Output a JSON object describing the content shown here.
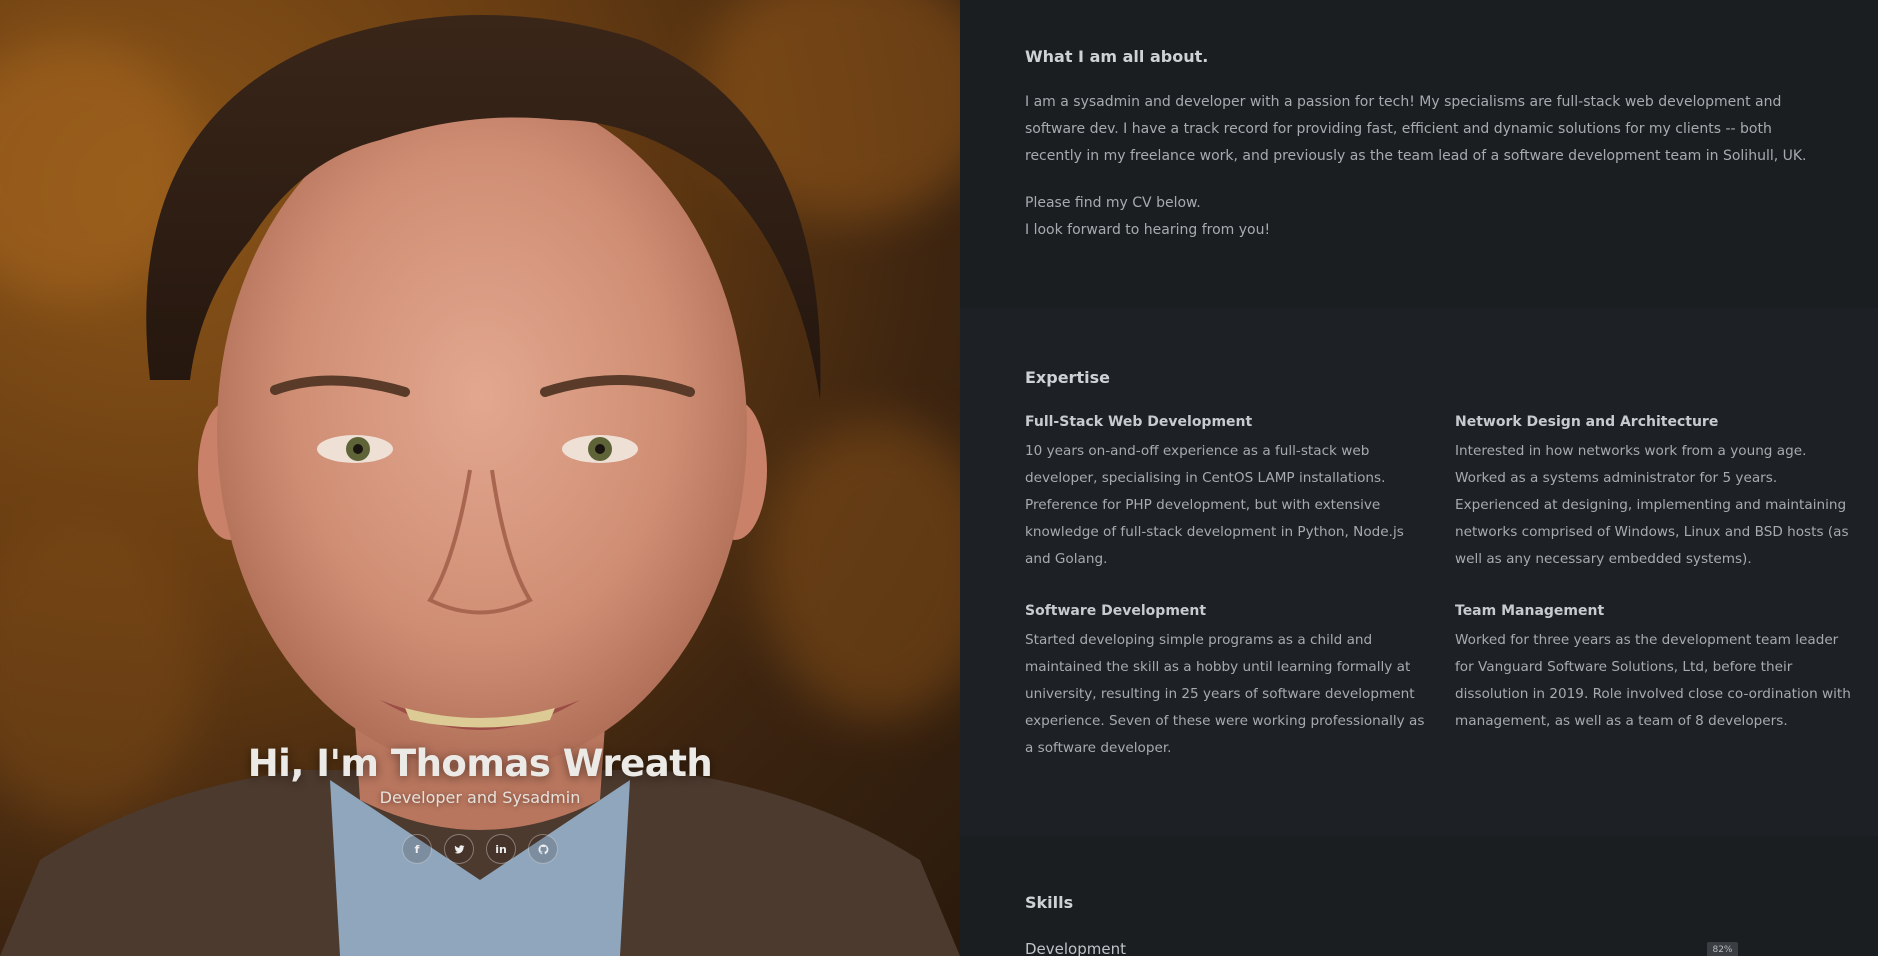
{
  "hero": {
    "name": "Hi, I'm Thomas Wreath",
    "role": "Developer and Sysadmin",
    "socials": [
      {
        "label": "f",
        "icon": "facebook-icon"
      },
      {
        "label": "twitter",
        "icon": "twitter-icon"
      },
      {
        "label": "in",
        "icon": "linkedin-icon"
      },
      {
        "label": "github",
        "icon": "github-icon"
      }
    ]
  },
  "about": {
    "title": "What I am all about.",
    "paragraph1": "I am a sysadmin and developer with a passion for tech! My specialisms are full-stack web development and software dev. I have a track record for providing fast, efficient and dynamic solutions for my clients -- both recently in my freelance work, and previously as the team lead of a software development team in Solihull, UK.",
    "paragraph2_line1": "Please find my CV below.",
    "paragraph2_line2": "I look forward to hearing from you!"
  },
  "expertise": {
    "title": "Expertise",
    "items": [
      {
        "title": "Full-Stack Web Development",
        "text": "10 years on-and-off experience as a full-stack web developer, specialising in CentOS LAMP installations. Preference for PHP development, but with extensive knowledge of full-stack development in Python, Node.js and Golang."
      },
      {
        "title": "Network Design and Architecture",
        "text": "Interested in how networks work from a young age. Worked as a systems administrator for 5 years. Experienced at designing, implementing and maintaining networks comprised of Windows, Linux and BSD hosts (as well as any necessary embedded systems)."
      },
      {
        "title": "Software Development",
        "text": "Started developing simple programs as a child and maintained the skill as a hobby until learning formally at university, resulting in 25 years of software development experience. Seven of these were working professionally as a software developer."
      },
      {
        "title": "Team Management",
        "text": "Worked for three years as the development team leader for Vanguard Software Solutions, Ltd, before their dissolution in 2019. Role involved close co-ordination with management, as well as a team of 8 developers."
      }
    ]
  },
  "skills": {
    "title": "Skills",
    "items": [
      {
        "label": "Development",
        "percent_label": "82%",
        "level": 0.82
      }
    ]
  },
  "colors": {
    "background": "#1b1e21",
    "heading": "#cfd2d5",
    "body_text": "#a7abb0",
    "hero_background": "#6a3e12"
  }
}
